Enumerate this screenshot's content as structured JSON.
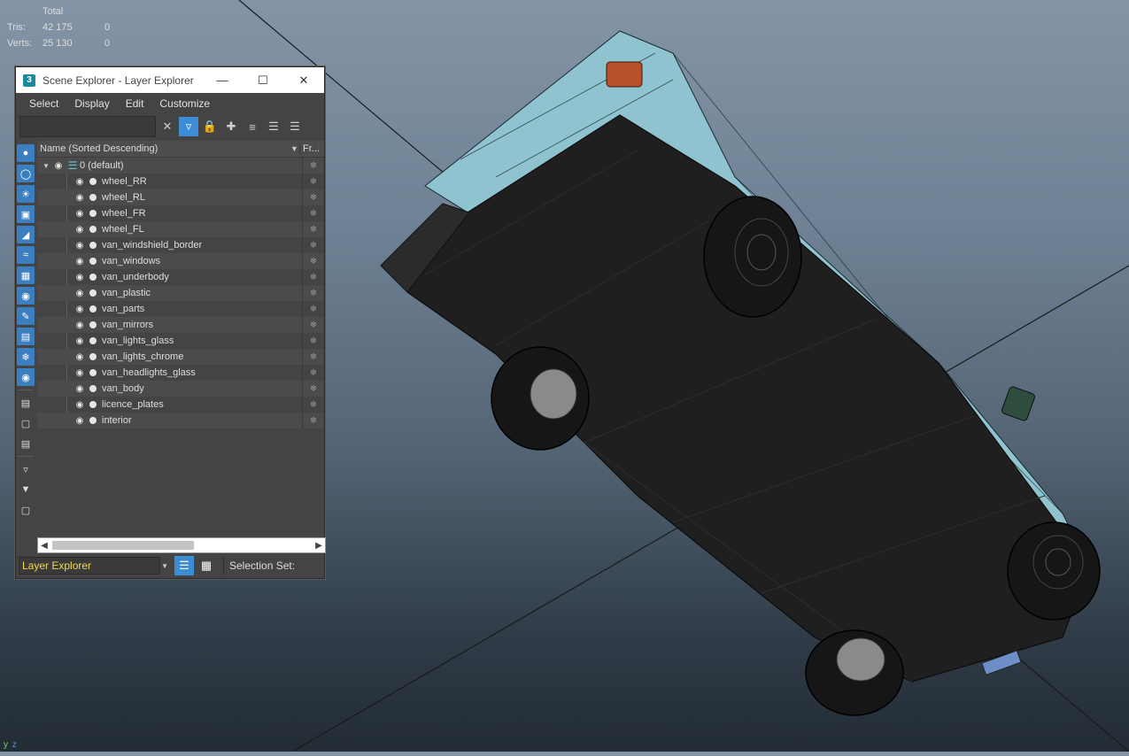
{
  "stats": {
    "header": "Total",
    "rows": [
      {
        "label": "Tris:",
        "value": "42 175",
        "selected": "0"
      },
      {
        "label": "Verts:",
        "value": "25 130",
        "selected": "0"
      }
    ]
  },
  "axis": {
    "y": "y",
    "z": "z"
  },
  "explorer": {
    "title": "Scene Explorer - Layer Explorer",
    "app_badge": "3",
    "menu": [
      "Select",
      "Display",
      "Edit",
      "Customize"
    ],
    "search_placeholder": "",
    "column_name": "Name (Sorted Descending)",
    "column_frozen": "Fr...",
    "default_layer": "0 (default)",
    "layers": [
      "wheel_RR",
      "wheel_RL",
      "wheel_FR",
      "wheel_FL",
      "van_windshield_border",
      "van_windows",
      "van_underbody",
      "van_plastic",
      "van_parts",
      "van_mirrors",
      "van_lights_glass",
      "van_lights_chrome",
      "van_headlights_glass",
      "van_body",
      "licence_plates",
      "interior"
    ],
    "dropdown_value": "Layer Explorer",
    "selection_set_label": "Selection Set:"
  },
  "colors": {
    "accent": "#3b8ed6",
    "van_body": "#8fc3d0",
    "underbody": "#1e1e1e",
    "dropdown_text": "#f0d94a"
  }
}
